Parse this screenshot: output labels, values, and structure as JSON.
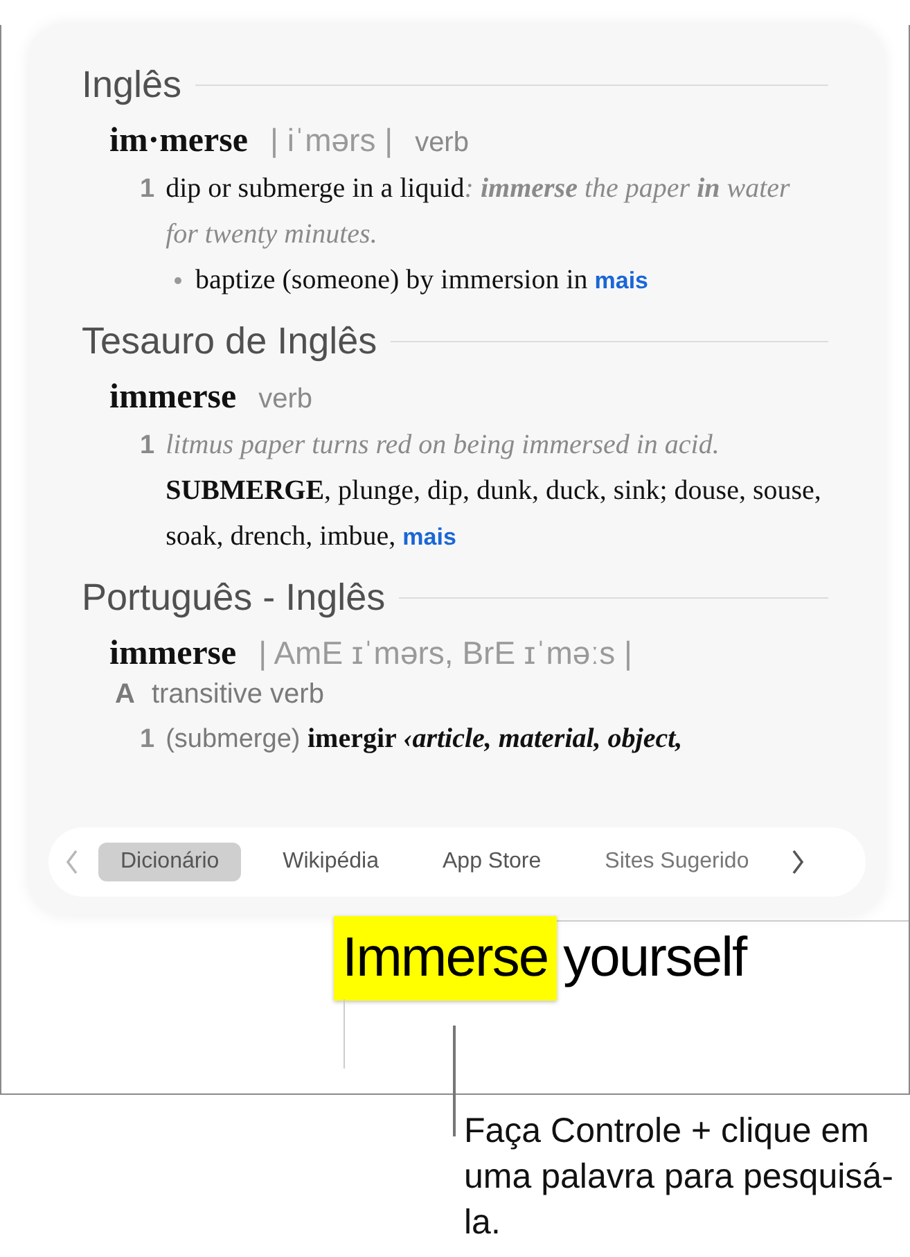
{
  "popover": {
    "sections": [
      {
        "title": "Inglês",
        "headword": "im·merse",
        "pronunciation": "| iˈmərs |",
        "pos": "verb",
        "senses": [
          {
            "number": "1",
            "parts": [
              {
                "kind": "text",
                "text": "dip or submerge in a liquid"
              },
              {
                "kind": "example",
                "text": ": **immerse** the paper **in** water for twenty minutes."
              }
            ],
            "bullets": [
              {
                "parts": [
                  {
                    "kind": "text",
                    "text": "baptize (someone) by immersion in "
                  },
                  {
                    "kind": "link",
                    "text": "mais"
                  }
                ]
              }
            ]
          }
        ]
      },
      {
        "title": "Tesauro de Inglês",
        "headword": "immerse",
        "pos": "verb",
        "senses": [
          {
            "number": "1",
            "parts": [
              {
                "kind": "example",
                "text": "litmus paper turns red on being immersed in acid."
              },
              {
                "kind": "text",
                "text": " **SUBMERGE**, plunge, dip, dunk, duck, sink; douse, souse, soak, drench, imbue, "
              },
              {
                "kind": "link",
                "text": "mais"
              }
            ]
          }
        ]
      },
      {
        "title": "Português - Inglês",
        "headword": "immerse",
        "pronunciation": "| AmE ɪˈmərs,  BrE ɪˈməːs |",
        "grammar": {
          "letter": "A",
          "label": "transitive verb"
        },
        "senses": [
          {
            "number": "1",
            "parts": [
              {
                "kind": "gloss",
                "text": "(submerge) "
              },
              {
                "kind": "strong",
                "text": "imergir "
              },
              {
                "kind": "collocate",
                "text": "‹article, material, object,"
              }
            ]
          }
        ]
      }
    ],
    "tabs": [
      {
        "label": "Dicionário",
        "selected": true
      },
      {
        "label": "Wikipédia",
        "selected": false
      },
      {
        "label": "App Store",
        "selected": false
      },
      {
        "label": "Sites Sugerido",
        "selected": false
      }
    ]
  },
  "document": {
    "highlighted_word": "Immerse",
    "rest": "yourself"
  },
  "caption": "Faça Controle + clique em uma palavra para pesquisá-la."
}
